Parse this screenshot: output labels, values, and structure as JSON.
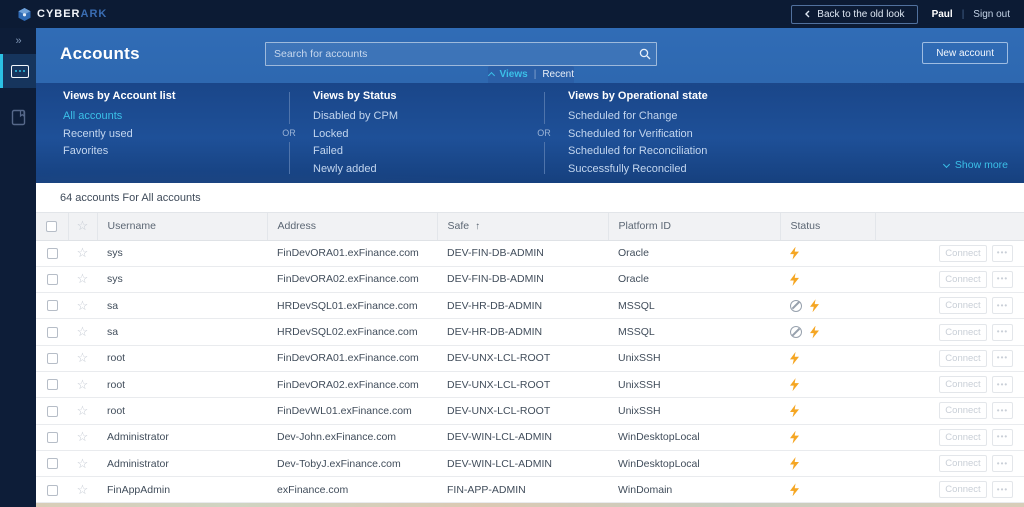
{
  "topbar": {
    "brand_bold": "CYBER",
    "brand_light": "ARK",
    "back_button": "Back to the old look",
    "user": "Paul",
    "divider": "|",
    "signout": "Sign out"
  },
  "header": {
    "title": "Accounts",
    "search_placeholder": "Search for accounts",
    "new_account": "New account"
  },
  "tabs": {
    "views": "Views",
    "divider": "|",
    "recent": "Recent"
  },
  "views_panel": {
    "columns": [
      {
        "title": "Views by Account list",
        "items": [
          {
            "label": "All accounts",
            "active": true
          },
          {
            "label": "Recently used",
            "active": false
          },
          {
            "label": "Favorites",
            "active": false
          }
        ]
      },
      {
        "title": "Views by Status",
        "items": [
          {
            "label": "Disabled by CPM",
            "active": false
          },
          {
            "label": "Locked",
            "active": false
          },
          {
            "label": "Failed",
            "active": false
          },
          {
            "label": "Newly added",
            "active": false
          }
        ]
      },
      {
        "title": "Views by Operational state",
        "items": [
          {
            "label": "Scheduled for Change",
            "active": false
          },
          {
            "label": "Scheduled for Verification",
            "active": false
          },
          {
            "label": "Scheduled for Reconciliation",
            "active": false
          },
          {
            "label": "Successfully Reconciled",
            "active": false
          }
        ]
      }
    ],
    "or_label": "OR",
    "show_more": "Show more"
  },
  "content": {
    "summary": "64 accounts For All accounts",
    "table": {
      "headers": {
        "username": "Username",
        "address": "Address",
        "safe": "Safe",
        "platform": "Platform ID",
        "status": "Status"
      },
      "sorted_column": "Safe",
      "sort_arrow": "↑",
      "actions": {
        "connect": "Connect",
        "more": "•••"
      },
      "rows": [
        {
          "username": "sys",
          "address": "FinDevORA01.exFinance.com",
          "safe": "DEV-FIN-DB-ADMIN",
          "platform": "Oracle",
          "status_icons": [
            "bolt"
          ]
        },
        {
          "username": "sys",
          "address": "FinDevORA02.exFinance.com",
          "safe": "DEV-FIN-DB-ADMIN",
          "platform": "Oracle",
          "status_icons": [
            "bolt"
          ]
        },
        {
          "username": "sa",
          "address": "HRDevSQL01.exFinance.com",
          "safe": "DEV-HR-DB-ADMIN",
          "platform": "MSSQL",
          "status_icons": [
            "blocked",
            "bolt"
          ]
        },
        {
          "username": "sa",
          "address": "HRDevSQL02.exFinance.com",
          "safe": "DEV-HR-DB-ADMIN",
          "platform": "MSSQL",
          "status_icons": [
            "blocked",
            "bolt"
          ]
        },
        {
          "username": "root",
          "address": "FinDevORA01.exFinance.com",
          "safe": "DEV-UNX-LCL-ROOT",
          "platform": "UnixSSH",
          "status_icons": [
            "bolt"
          ]
        },
        {
          "username": "root",
          "address": "FinDevORA02.exFinance.com",
          "safe": "DEV-UNX-LCL-ROOT",
          "platform": "UnixSSH",
          "status_icons": [
            "bolt"
          ]
        },
        {
          "username": "root",
          "address": "FinDevWL01.exFinance.com",
          "safe": "DEV-UNX-LCL-ROOT",
          "platform": "UnixSSH",
          "status_icons": [
            "bolt"
          ]
        },
        {
          "username": "Administrator",
          "address": "Dev-John.exFinance.com",
          "safe": "DEV-WIN-LCL-ADMIN",
          "platform": "WinDesktopLocal",
          "status_icons": [
            "bolt"
          ]
        },
        {
          "username": "Administrator",
          "address": "Dev-TobyJ.exFinance.com",
          "safe": "DEV-WIN-LCL-ADMIN",
          "platform": "WinDesktopLocal",
          "status_icons": [
            "bolt"
          ]
        },
        {
          "username": "FinAppAdmin",
          "address": "exFinance.com",
          "safe": "FIN-APP-ADMIN",
          "platform": "WinDomain",
          "status_icons": [
            "bolt"
          ]
        }
      ]
    }
  },
  "colors": {
    "accent_cyan": "#3BC0E8",
    "header_blue": "#2E68B0",
    "panel_blue": "#1D4E95",
    "topbar_navy": "#0C1B34",
    "bolt_orange": "#F5A623",
    "blocked_gray": "#97A1AD"
  }
}
